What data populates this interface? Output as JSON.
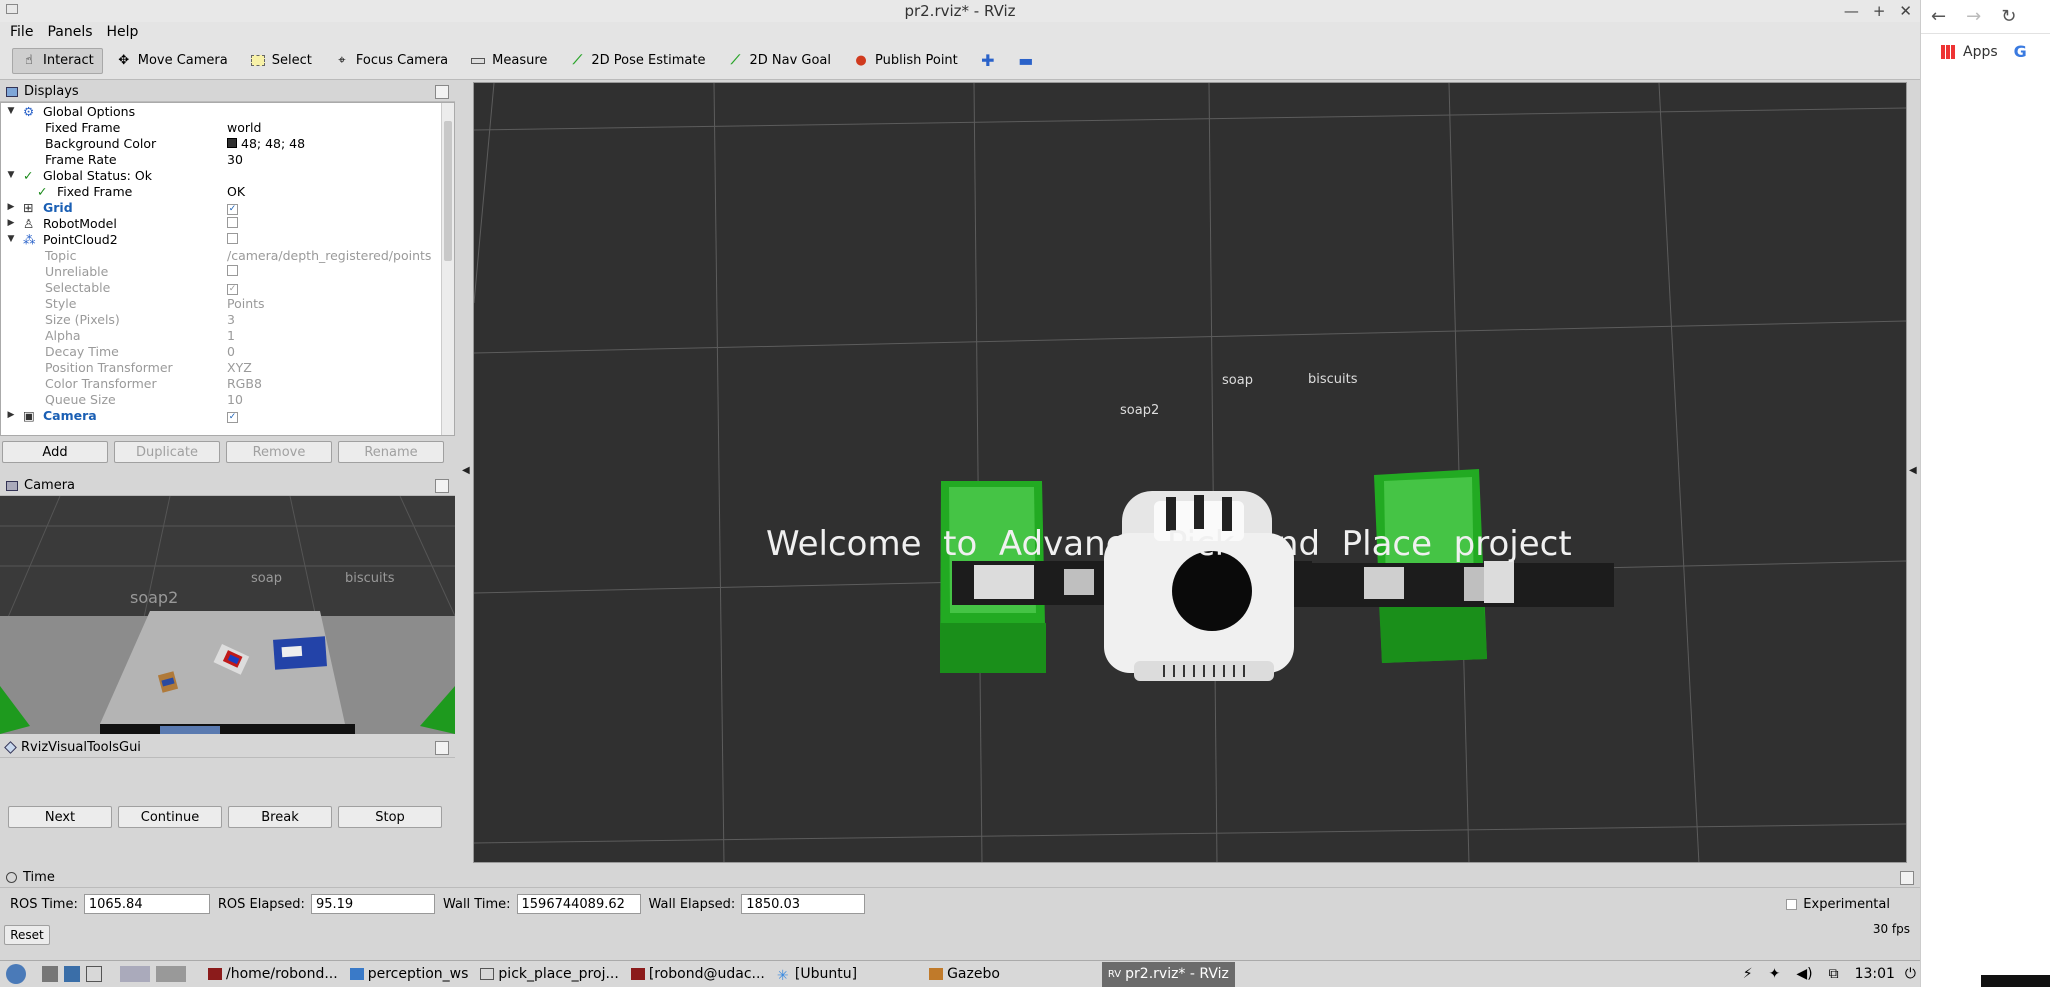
{
  "window": {
    "title": "pr2.rviz* - RViz",
    "controls": [
      "—",
      "+",
      "✕"
    ]
  },
  "menu": [
    "File",
    "Panels",
    "Help"
  ],
  "toolbar": {
    "tools": [
      {
        "label": "Interact",
        "icon": "hand-icon",
        "active": true
      },
      {
        "label": "Move Camera",
        "icon": "move-icon"
      },
      {
        "label": "Select",
        "icon": "select-box-icon"
      },
      {
        "label": "Focus Camera",
        "icon": "focus-icon"
      },
      {
        "label": "Measure",
        "icon": "ruler-icon"
      },
      {
        "label": "2D Pose Estimate",
        "icon": "green-arrow-icon"
      },
      {
        "label": "2D Nav Goal",
        "icon": "green-arrow-icon"
      },
      {
        "label": "Publish Point",
        "icon": "map-pin-icon"
      }
    ]
  },
  "displays": {
    "title": "Displays",
    "rows": [
      {
        "k": "Global Options",
        "v": "",
        "level": 0,
        "expand": "▼",
        "type": "gear"
      },
      {
        "k": "Fixed Frame",
        "v": "world",
        "level": 1
      },
      {
        "k": "Background Color",
        "v": "48; 48; 48",
        "level": 1,
        "swatch": true
      },
      {
        "k": "Frame Rate",
        "v": "30",
        "level": 1
      },
      {
        "k": "Global Status: Ok",
        "v": "",
        "level": 0,
        "expand": "▼",
        "type": "check"
      },
      {
        "k": "Fixed Frame",
        "v": "OK",
        "level": 1,
        "type": "check"
      },
      {
        "k": "Grid",
        "v": "",
        "level": 0,
        "expand": "▶",
        "type": "grid",
        "blue": true,
        "checked": true
      },
      {
        "k": "RobotModel",
        "v": "",
        "level": 0,
        "expand": "▶",
        "type": "robot",
        "checked": false
      },
      {
        "k": "PointCloud2",
        "v": "",
        "level": 0,
        "expand": "▼",
        "type": "cloud",
        "checked": false
      },
      {
        "k": "Topic",
        "v": "/camera/depth_registered/points",
        "level": 1,
        "dim": true
      },
      {
        "k": "Unreliable",
        "v": "",
        "level": 1,
        "dim": true,
        "checked": false
      },
      {
        "k": "Selectable",
        "v": "",
        "level": 1,
        "dim": true,
        "checked": true
      },
      {
        "k": "Style",
        "v": "Points",
        "level": 1,
        "dim": true
      },
      {
        "k": "Size (Pixels)",
        "v": "3",
        "level": 1,
        "dim": true
      },
      {
        "k": "Alpha",
        "v": "1",
        "level": 1,
        "dim": true
      },
      {
        "k": "Decay Time",
        "v": "0",
        "level": 1,
        "dim": true
      },
      {
        "k": "Position Transformer",
        "v": "XYZ",
        "level": 1,
        "dim": true
      },
      {
        "k": "Color Transformer",
        "v": "RGB8",
        "level": 1,
        "dim": true
      },
      {
        "k": "Queue Size",
        "v": "10",
        "level": 1,
        "dim": true
      },
      {
        "k": "Camera",
        "v": "",
        "level": 0,
        "expand": "▶",
        "type": "camera",
        "blue": true,
        "checked": true
      }
    ],
    "buttons": [
      {
        "label": "Add",
        "enabled": true
      },
      {
        "label": "Duplicate",
        "enabled": false
      },
      {
        "label": "Remove",
        "enabled": false
      },
      {
        "label": "Rename",
        "enabled": false
      }
    ]
  },
  "camera_panel": {
    "title": "Camera",
    "labels": {
      "soap2": "soap2",
      "soap": "soap",
      "biscuits": "biscuits"
    }
  },
  "rvtg": {
    "title": "RvizVisualToolsGui",
    "buttons": [
      "Next",
      "Continue",
      "Break",
      "Stop"
    ]
  },
  "viewport": {
    "welcome": "Welcome  to  Advance  Pick  and  Place  project",
    "labels": {
      "soap2": "soap2",
      "soap": "soap",
      "biscuits": "biscuits"
    },
    "background_color": "#303030"
  },
  "time": {
    "title": "Time",
    "ros_time_label": "ROS Time:",
    "ros_time": "1065.84",
    "ros_elapsed_label": "ROS Elapsed:",
    "ros_elapsed": "95.19",
    "wall_time_label": "Wall Time:",
    "wall_time": "1596744089.62",
    "wall_elapsed_label": "Wall Elapsed:",
    "wall_elapsed": "1850.03",
    "experimental_label": "Experimental",
    "reset_label": "Reset",
    "fps": "30 fps"
  },
  "taskbar": {
    "tasks": [
      {
        "label": "/home/robond...",
        "icon": "terminal-icon"
      },
      {
        "label": "perception_ws",
        "icon": "folder-icon"
      },
      {
        "label": "pick_place_proj...",
        "icon": "editor-icon"
      },
      {
        "label": "[robond@udac...",
        "icon": "terminal-icon"
      },
      {
        "label": "[Ubuntu]",
        "icon": "ubuntu-icon"
      },
      {
        "label": "Gazebo",
        "icon": "gazebo-icon"
      },
      {
        "label": "pr2.rviz* - RViz",
        "icon": "rviz-icon",
        "active": true
      }
    ],
    "clock": "13:01"
  },
  "browser_strip": {
    "apps_label": "Apps"
  }
}
